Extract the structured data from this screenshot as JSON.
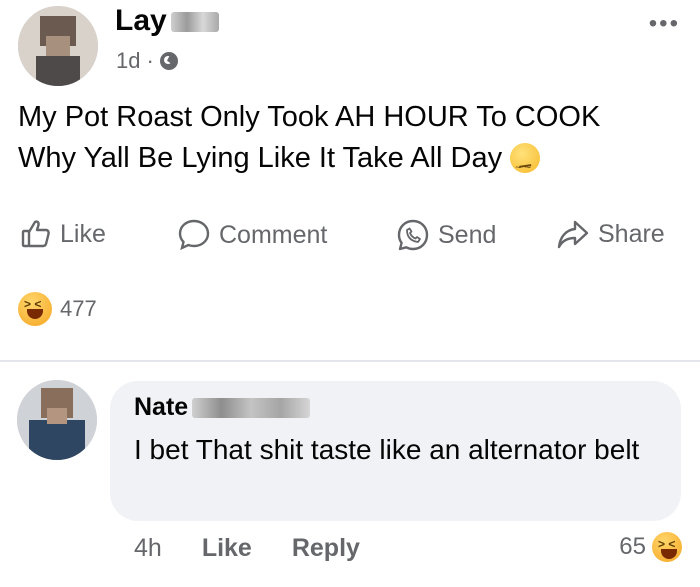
{
  "post": {
    "author": "Lay",
    "age": "1d",
    "separator": "·",
    "more_label": "•••",
    "text_line1": "My Pot Roast Only Took AH HOUR To COOK",
    "text_line2": "Why Yall Be Lying Like It Take All Day"
  },
  "actions": {
    "like": "Like",
    "comment": "Comment",
    "send": "Send",
    "share": "Share"
  },
  "reactions": {
    "count": "477"
  },
  "comment": {
    "author": "Nate",
    "text": "I bet That shit taste like an alternator belt",
    "time": "4h",
    "like": "Like",
    "reply": "Reply",
    "reaction_count": "65"
  },
  "colors": {
    "secondary_text": "#65676b",
    "bubble": "#f0f2f5"
  },
  "icons": [
    "globe-icon",
    "like-icon",
    "comment-icon",
    "send-icon",
    "share-icon",
    "haha-reaction-icon",
    "smirk-emoji"
  ]
}
